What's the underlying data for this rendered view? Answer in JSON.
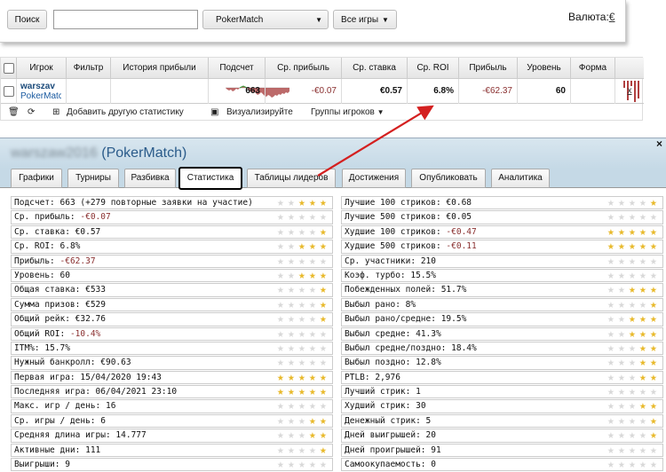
{
  "toolbar": {
    "search_label": "Поиск",
    "search_value": "",
    "site_select": "PokerMatch",
    "games_select": "Все игры",
    "currency_label": "Валюта:",
    "currency_symbol": "€"
  },
  "table": {
    "headers": [
      "Игрок",
      "Фильтр",
      "История прибыли",
      "Подсчет",
      "Ср. прибыль",
      "Ср. ставка",
      "Ср. ROI",
      "Прибыль",
      "Уровень",
      "Форма"
    ],
    "row": {
      "player_name": "warszav",
      "player_site": "PokerMatc",
      "count": "663",
      "avg_profit": "-€0.07",
      "avg_stake": "€0.57",
      "avg_roi": "6.8%",
      "profit": "-€62.37",
      "level": "60",
      "remove": "x"
    },
    "actions": {
      "add_stat": "Добавить другую статистику",
      "visualize": "Визуализируйте",
      "groups": "Группы игроков"
    }
  },
  "panel": {
    "player_blurred": "warszaw2016",
    "site": "(PokerMatch)",
    "close": "×",
    "tabs": [
      "Графики",
      "Турниры",
      "Разбивка",
      "Статистика",
      "Таблицы лидеров",
      "Достижения",
      "Опубликовать",
      "Аналитика"
    ]
  },
  "stats_left": [
    {
      "label": "Подсчет:",
      "value": "663 (+279 повторные заявки на участие)",
      "stars": 3,
      "neg": false
    },
    {
      "label": "Ср. прибыль:",
      "value": "-€0.07",
      "stars": 0,
      "neg": true
    },
    {
      "label": "Ср. ставка:",
      "value": "€0.57",
      "stars": 1,
      "neg": false
    },
    {
      "label": "Ср. ROI:",
      "value": "6.8%",
      "stars": 3,
      "neg": false
    },
    {
      "label": "Прибыль:",
      "value": "-€62.37",
      "stars": 0,
      "neg": true
    },
    {
      "label": "Уровень:",
      "value": "60",
      "stars": 3,
      "neg": false
    },
    {
      "label": "Общая ставка:",
      "value": "€533",
      "stars": 1,
      "neg": false
    },
    {
      "label": "Сумма призов:",
      "value": "€529",
      "stars": 1,
      "neg": false
    },
    {
      "label": "Общий рейк:",
      "value": "€32.76",
      "stars": 1,
      "neg": false
    },
    {
      "label": "Общий ROI:",
      "value": "-10.4%",
      "stars": 0,
      "neg": true
    },
    {
      "label": "ITM%:",
      "value": "15.7%",
      "stars": 0,
      "neg": false
    },
    {
      "label": "Нужный банкролл:",
      "value": "€90.63",
      "stars": 0,
      "neg": false
    },
    {
      "label": "Первая игра:",
      "value": "15/04/2020 19:43",
      "stars": 5,
      "neg": false
    },
    {
      "label": "Последняя игра:",
      "value": "06/04/2021 23:10",
      "stars": 5,
      "neg": false
    },
    {
      "label": "Макс. игр / день:",
      "value": "16",
      "stars": 0,
      "neg": false
    },
    {
      "label": "Ср. игры / день:",
      "value": "6",
      "stars": 2,
      "neg": false
    },
    {
      "label": "Средняя длина игры:",
      "value": "14.777",
      "stars": 2,
      "neg": false
    },
    {
      "label": "Активные дни:",
      "value": "111",
      "stars": 1,
      "neg": false
    },
    {
      "label": "Выигрыши:",
      "value": "9",
      "stars": 0,
      "neg": false
    }
  ],
  "stats_right": [
    {
      "label": "Лучшие 100 стриков:",
      "value": "€0.68",
      "stars": 1,
      "neg": false
    },
    {
      "label": "Лучшие 500 стриков:",
      "value": "€0.05",
      "stars": 0,
      "neg": false
    },
    {
      "label": "Худшие 100 стриков:",
      "value": "-€0.47",
      "stars": 5,
      "neg": true
    },
    {
      "label": "Худшие 500 стриков:",
      "value": "-€0.11",
      "stars": 5,
      "neg": true
    },
    {
      "label": "Ср. участники:",
      "value": "210",
      "stars": 0,
      "neg": false
    },
    {
      "label": "Коэф. турбо:",
      "value": "15.5%",
      "stars": 0,
      "neg": false
    },
    {
      "label": "Побежденных полей:",
      "value": "51.7%",
      "stars": 3,
      "neg": false
    },
    {
      "label": "Выбыл рано:",
      "value": "8%",
      "stars": 1,
      "neg": false
    },
    {
      "label": "Выбыл рано/средне:",
      "value": "19.5%",
      "stars": 3,
      "neg": false
    },
    {
      "label": "Выбыл средне:",
      "value": "41.3%",
      "stars": 3,
      "neg": false
    },
    {
      "label": "Выбыл средне/поздно:",
      "value": "18.4%",
      "stars": 2,
      "neg": false
    },
    {
      "label": "Выбыл поздно:",
      "value": "12.8%",
      "stars": 2,
      "neg": false
    },
    {
      "label": "PTLB:",
      "value": "2,976",
      "stars": 2,
      "neg": false
    },
    {
      "label": "Лучший стрик:",
      "value": "1",
      "stars": 0,
      "neg": false
    },
    {
      "label": "Худший стрик:",
      "value": "30",
      "stars": 2,
      "neg": false
    },
    {
      "label": "Денежный стрик:",
      "value": "5",
      "stars": 1,
      "neg": false
    },
    {
      "label": "Дней выигрышей:",
      "value": "20",
      "stars": 1,
      "neg": false
    },
    {
      "label": "Дней проигрышей:",
      "value": "91",
      "stars": 0,
      "neg": false
    },
    {
      "label": "Самоокупаемость:",
      "value": "0",
      "stars": 0,
      "neg": false
    }
  ],
  "colors": {
    "negative": "#8a3030",
    "star_on": "#e8b92a",
    "star_off": "#d8d8d8",
    "title": "#2a5b8a",
    "arrow": "#d42020"
  }
}
